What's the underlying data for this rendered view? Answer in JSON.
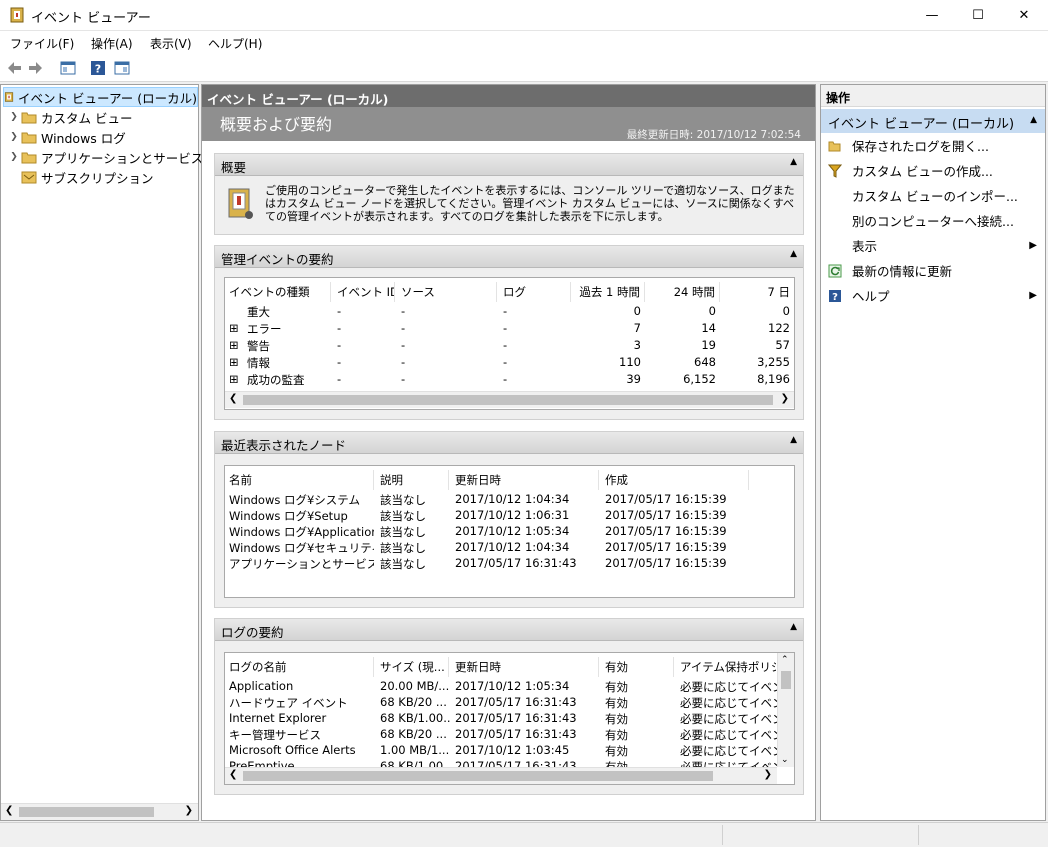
{
  "window": {
    "title": "イベント ビューアー",
    "min": "—",
    "max": "☐",
    "close": "✕"
  },
  "menu": [
    "ファイル(F)",
    "操作(A)",
    "表示(V)",
    "ヘルプ(H)"
  ],
  "tree": {
    "root": "イベント ビューアー (ローカル)",
    "items": [
      {
        "label": "カスタム ビュー",
        "expandable": true
      },
      {
        "label": "Windows ログ",
        "expandable": true
      },
      {
        "label": "アプリケーションとサービス ログ",
        "expandable": true
      },
      {
        "label": "サブスクリプション",
        "expandable": false
      }
    ]
  },
  "center": {
    "header": "イベント ビューアー (ローカル)",
    "banner_title": "概要および要約",
    "last_updated": "最終更新日時: 2017/10/12 7:02:54",
    "overview": {
      "title": "概要",
      "text": "ご使用のコンピューターで発生したイベントを表示するには、コンソール ツリーで適切なソース、ログまたはカスタム ビュー ノードを選択してください。管理イベント カスタム ビューには、ソースに関係なくすべての管理イベントが表示されます。すべてのログを集計した表示を下に示します。"
    },
    "admin_summary": {
      "title": "管理イベントの要約",
      "columns": [
        "イベントの種類",
        "イベント ID",
        "ソース",
        "ログ",
        "過去 1 時間",
        "24 時間",
        "7 日"
      ],
      "rows": [
        {
          "type": "重大",
          "expand": "",
          "id": "-",
          "src": "-",
          "log": "-",
          "h1": "0",
          "h24": "0",
          "d7": "0"
        },
        {
          "type": "エラー",
          "expand": "⊞",
          "id": "-",
          "src": "-",
          "log": "-",
          "h1": "7",
          "h24": "14",
          "d7": "122"
        },
        {
          "type": "警告",
          "expand": "⊞",
          "id": "-",
          "src": "-",
          "log": "-",
          "h1": "3",
          "h24": "19",
          "d7": "57"
        },
        {
          "type": "情報",
          "expand": "⊞",
          "id": "-",
          "src": "-",
          "log": "-",
          "h1": "110",
          "h24": "648",
          "d7": "3,255"
        },
        {
          "type": "成功の監査",
          "expand": "⊞",
          "id": "-",
          "src": "-",
          "log": "-",
          "h1": "39",
          "h24": "6,152",
          "d7": "8,196"
        }
      ]
    },
    "recent_nodes": {
      "title": "最近表示されたノード",
      "columns": [
        "名前",
        "説明",
        "更新日時",
        "作成"
      ],
      "rows": [
        {
          "name": "Windows ログ¥システム",
          "desc": "該当なし",
          "updated": "2017/10/12 1:04:34",
          "created": "2017/05/17 16:15:39"
        },
        {
          "name": "Windows ログ¥Setup",
          "desc": "該当なし",
          "updated": "2017/10/12 1:06:31",
          "created": "2017/05/17 16:15:39"
        },
        {
          "name": "Windows ログ¥Application",
          "desc": "該当なし",
          "updated": "2017/10/12 1:05:34",
          "created": "2017/05/17 16:15:39"
        },
        {
          "name": "Windows ログ¥セキュリティ",
          "desc": "該当なし",
          "updated": "2017/10/12 1:04:34",
          "created": "2017/05/17 16:15:39"
        },
        {
          "name": "アプリケーションとサービス ログ...",
          "desc": "該当なし",
          "updated": "2017/05/17 16:31:43",
          "created": "2017/05/17 16:15:39"
        }
      ]
    },
    "log_summary": {
      "title": "ログの要約",
      "columns": [
        "ログの名前",
        "サイズ (現...",
        "更新日時",
        "有効",
        "アイテム保持ポリシー"
      ],
      "rows": [
        {
          "name": "Application",
          "size": "20.00 MB/...",
          "updated": "2017/10/12 1:05:34",
          "enabled": "有効",
          "policy": "必要に応じてイベント"
        },
        {
          "name": "ハードウェア イベント",
          "size": "68 KB/20 ...",
          "updated": "2017/05/17 16:31:43",
          "enabled": "有効",
          "policy": "必要に応じてイベント"
        },
        {
          "name": "Internet Explorer",
          "size": "68 KB/1.00...",
          "updated": "2017/05/17 16:31:43",
          "enabled": "有効",
          "policy": "必要に応じてイベント"
        },
        {
          "name": "キー管理サービス",
          "size": "68 KB/20 ...",
          "updated": "2017/05/17 16:31:43",
          "enabled": "有効",
          "policy": "必要に応じてイベント"
        },
        {
          "name": "Microsoft Office Alerts",
          "size": "1.00 MB/1...",
          "updated": "2017/10/12 1:03:45",
          "enabled": "有効",
          "policy": "必要に応じてイベント"
        },
        {
          "name": "PreEmptive",
          "size": "68 KB/1.00...",
          "updated": "2017/05/17 16:31:43",
          "enabled": "有効",
          "policy": "必要に応じてイベント"
        }
      ]
    }
  },
  "actions": {
    "header": "操作",
    "selected": "イベント ビューアー (ローカル)",
    "items": [
      {
        "label": "保存されたログを開く...",
        "icon": "folder-open-icon",
        "submenu": false
      },
      {
        "label": "カスタム ビューの作成...",
        "icon": "filter-icon",
        "submenu": false
      },
      {
        "label": "カスタム ビューのインポー...",
        "icon": "",
        "submenu": false
      },
      {
        "label": "別のコンピューターへ接続...",
        "icon": "",
        "submenu": false
      },
      {
        "label": "表示",
        "icon": "",
        "submenu": true
      },
      {
        "label": "最新の情報に更新",
        "icon": "refresh-icon",
        "submenu": false
      },
      {
        "label": "ヘルプ",
        "icon": "help-icon",
        "submenu": true
      }
    ]
  }
}
